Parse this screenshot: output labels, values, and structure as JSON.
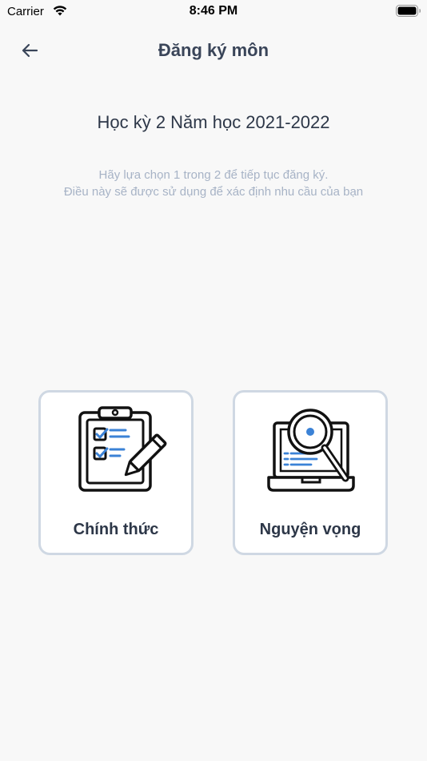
{
  "status_bar": {
    "carrier": "Carrier",
    "time": "8:46 PM"
  },
  "nav": {
    "title": "Đăng ký môn"
  },
  "semester": {
    "title": "Học kỳ 2 Năm học 2021-2022"
  },
  "instructions": {
    "line1": "Hãy lựa chọn 1 trong 2 để tiếp tục đăng ký.",
    "line2": "Điều này sẽ được sử dụng để xác định nhu cầu của bạn"
  },
  "options": [
    {
      "label": "Chính thức",
      "icon": "clipboard-checklist-icon"
    },
    {
      "label": "Nguyện vọng",
      "icon": "laptop-search-icon"
    }
  ],
  "colors": {
    "accent_blue": "#3b82d6",
    "card_border": "#cfd8e3",
    "title_text": "#3a4559",
    "muted_text": "#a7b3c6"
  }
}
